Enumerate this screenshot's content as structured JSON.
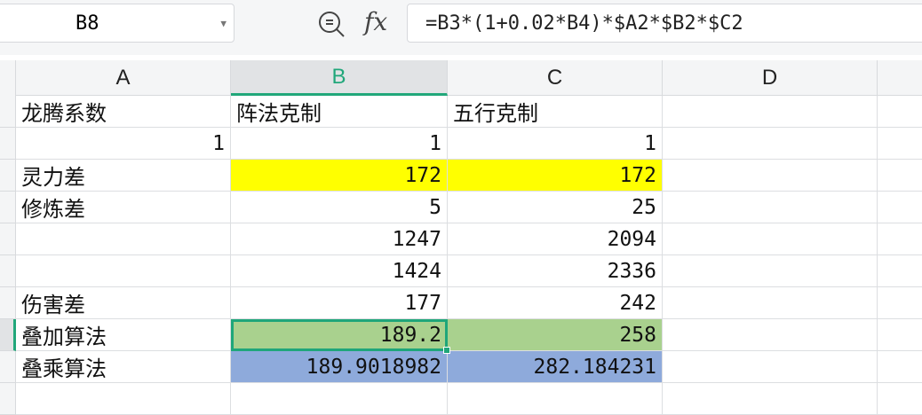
{
  "toolbar": {
    "name_box": "B8",
    "fx_label": "fx",
    "formula": "=B3*(1+0.02*B4)*$A2*$B2*$C2"
  },
  "columns": [
    "A",
    "B",
    "C",
    "D"
  ],
  "selected_column": "B",
  "colors": {
    "yellow": "#ffff00",
    "green": "#a9d18e",
    "blue": "#8eaadb",
    "accent": "#21a77a"
  },
  "rows": [
    {
      "A": "龙腾系数",
      "B": "阵法克制",
      "C": "五行克制",
      "D": ""
    },
    {
      "A": "1",
      "B": "1",
      "C": "1",
      "D": ""
    },
    {
      "A": "灵力差",
      "B": "172",
      "C": "172",
      "D": "",
      "fill": "yellow"
    },
    {
      "A": "修炼差",
      "B": "5",
      "C": "25",
      "D": ""
    },
    {
      "A": "",
      "B": "1247",
      "C": "2094",
      "D": ""
    },
    {
      "A": "",
      "B": "1424",
      "C": "2336",
      "D": ""
    },
    {
      "A": "伤害差",
      "B": "177",
      "C": "242",
      "D": ""
    },
    {
      "A": "叠加算法",
      "B": "189.2",
      "C": "258",
      "D": "",
      "fill": "green"
    },
    {
      "A": "叠乘算法",
      "B": "189.9018982",
      "C": "282.184231",
      "D": "",
      "fill": "blue"
    },
    {
      "A": "",
      "B": "",
      "C": "",
      "D": ""
    }
  ]
}
